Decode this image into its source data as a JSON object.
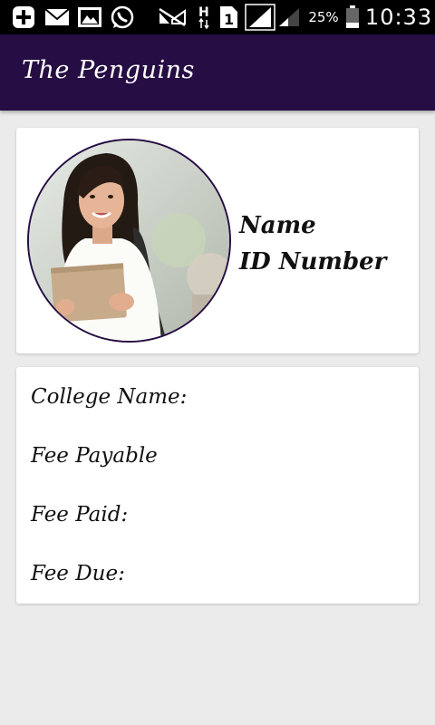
{
  "status_bar": {
    "icons": [
      "add-box-icon",
      "mail-icon",
      "image-icon",
      "whatsapp-icon",
      "signal-off-icon",
      "network-h-icon",
      "sim-1-icon",
      "signal-full-icon",
      "signal-weak-icon"
    ],
    "battery_percent": "25%",
    "battery_level": 0.25,
    "time": "10:33"
  },
  "app_bar": {
    "title": "The Penguins",
    "color": "#260d44"
  },
  "profile": {
    "name_label": "Name",
    "id_label": "ID Number",
    "avatar": "student-photo"
  },
  "details": {
    "college_label": "College Name:",
    "fee_payable_label": "Fee Payable",
    "fee_paid_label": "Fee Paid:",
    "fee_due_label": "Fee Due:"
  }
}
